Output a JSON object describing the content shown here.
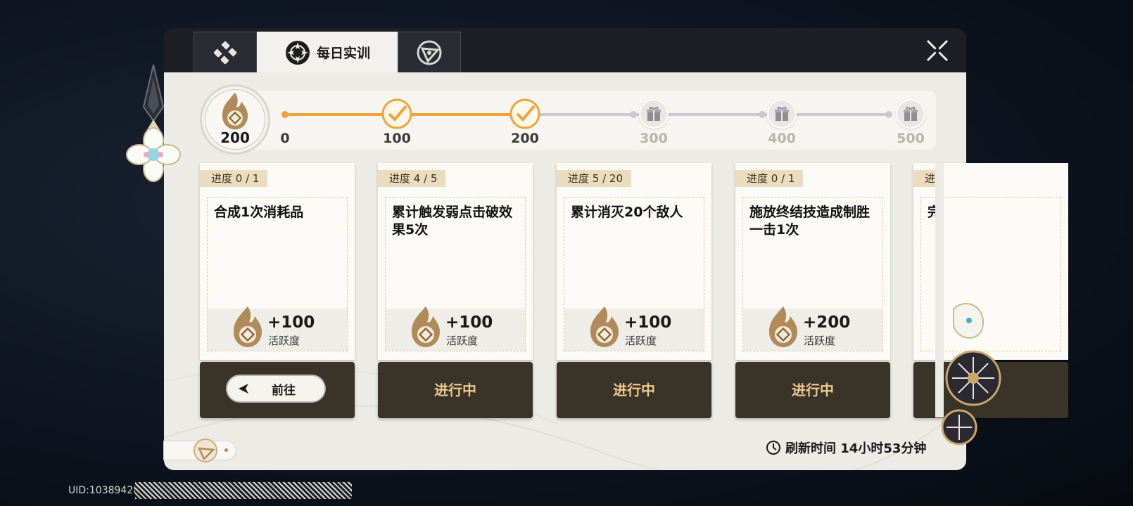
{
  "tabs": [
    {
      "label": "",
      "icon": "shield-logo-icon",
      "active": false
    },
    {
      "label": "每日实训",
      "icon": "daily-training-icon",
      "active": true
    },
    {
      "label": "",
      "icon": "triangle-emblem-icon",
      "active": false
    }
  ],
  "activity": {
    "current": "200",
    "milestones": [
      "0",
      "100",
      "200",
      "300",
      "400",
      "500"
    ],
    "claimed": [
      false,
      true,
      true,
      false,
      false,
      false
    ]
  },
  "cards": [
    {
      "progress": "进度  0 / 1",
      "title": "合成1次消耗品",
      "reward": "+100",
      "reward_label": "活跃度",
      "action": "前往",
      "status": ""
    },
    {
      "progress": "进度  4 / 5",
      "title": "累计触发弱点击破效果5次",
      "reward": "+100",
      "reward_label": "活跃度",
      "action": "",
      "status": "进行中"
    },
    {
      "progress": "进度  5 / 20",
      "title": "累计消灭20个敌人",
      "reward": "+100",
      "reward_label": "活跃度",
      "action": "",
      "status": "进行中"
    },
    {
      "progress": "进度  0 / 1",
      "title": "施放终结技造成制胜一击1次",
      "reward": "+200",
      "reward_label": "活跃度",
      "action": "",
      "status": "进行中"
    },
    {
      "progress": "进",
      "title": "完",
      "reward": "",
      "reward_label": "",
      "action": "",
      "status": ""
    }
  ],
  "refresh_text": "刷新时间 14小时53分钟",
  "uid": "UID:10389428",
  "colors": {
    "accent": "#f0a33b",
    "card_action_bg": "#3a3328",
    "status_text": "#e9c98d"
  }
}
